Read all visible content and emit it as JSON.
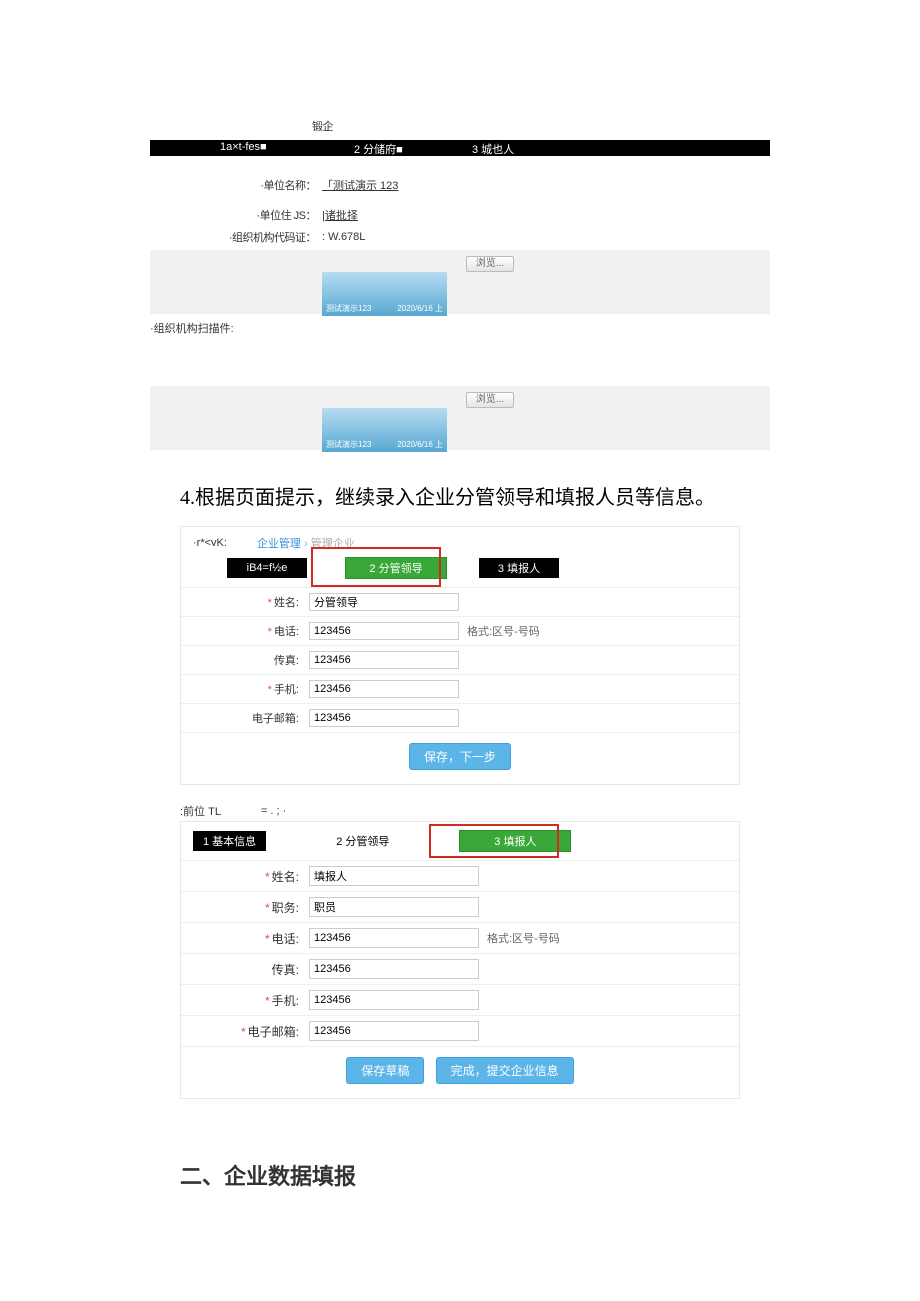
{
  "topCaption": "锻企",
  "bar1": {
    "t1": "1a×t-fes■",
    "t2": "2 分储府■",
    "t3": "3 城也人"
  },
  "formA": {
    "unitNameLabel": "·单位名称：",
    "unitNameValue": "「测试演示 123",
    "unitAddrLabel": "·单位住 JS：",
    "unitAddrValue": "|诸批择",
    "orgCodeLabel": "·组织机构代码证：",
    "orgCodeValue": ": W.678L"
  },
  "browse": "浏览...",
  "thumb": {
    "left": "测试演示123",
    "right": "2020/6/16 上"
  },
  "scanLabel": "·组织机构扫描件:",
  "bodyText": "4.根据页面提示，继续录入企业分管领导和填报人员等信息。",
  "panel1": {
    "headLeft": "·r*<vK:",
    "bcA": "企业管理",
    "bcSep": "›",
    "bcB": "管理企业",
    "tab1": "iB4=f½e",
    "tab2": "2 分管领导",
    "tab3": "3 填报人",
    "rows": {
      "name": {
        "label": "姓名:",
        "value": "分管领导"
      },
      "tel": {
        "label": "电话:",
        "value": "123456",
        "hint": "格式:区号-号码"
      },
      "fax": {
        "label": "传真:",
        "value": "123456"
      },
      "mob": {
        "label": "手机:",
        "value": "123456"
      },
      "email": {
        "label": "电子邮箱:",
        "value": "123456"
      }
    },
    "action": "保存，下一步"
  },
  "midHead": {
    "left": ":前位 TL",
    "mid": "= . ;   ·"
  },
  "panel2": {
    "tab1": "1 基本信息",
    "tab2": "2 分管领导",
    "tab3": "3 填报人",
    "rows": {
      "name": {
        "label": "姓名:",
        "value": "填报人"
      },
      "job": {
        "label": "职务:",
        "value": "职员"
      },
      "tel": {
        "label": "电话:",
        "value": "123456",
        "hint": "格式:区号-号码"
      },
      "fax": {
        "label": "传真:",
        "value": "123456"
      },
      "mob": {
        "label": "手机:",
        "value": "123456"
      },
      "email": {
        "label": "电子邮箱:",
        "value": "123456"
      }
    },
    "actionA": "保存草稿",
    "actionB": "完成，提交企业信息"
  },
  "h2": "二、企业数据填报",
  "star": "*"
}
